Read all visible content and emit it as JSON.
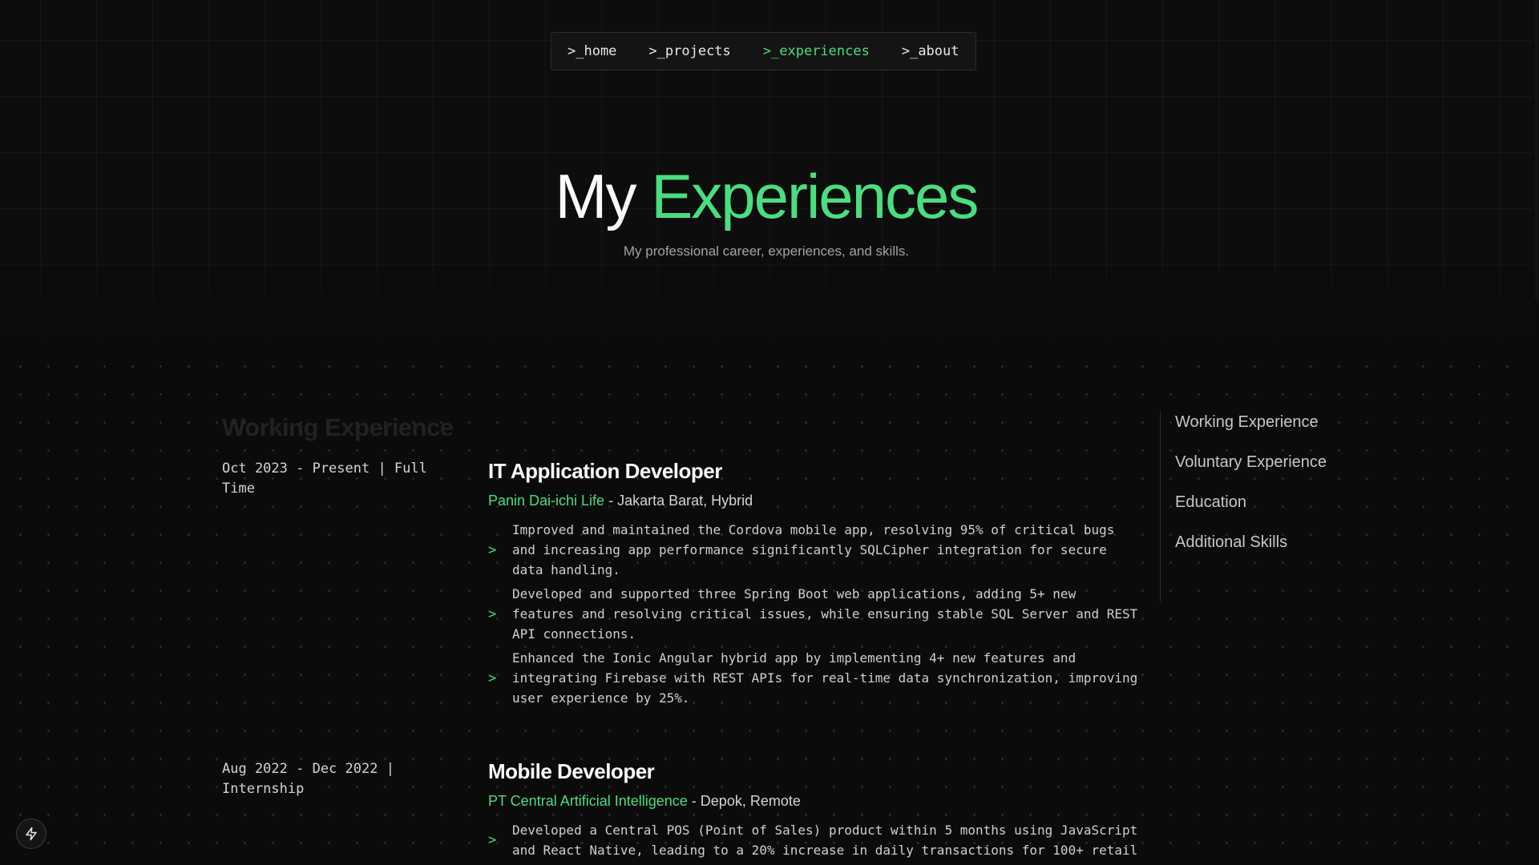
{
  "nav": {
    "items": [
      {
        "label": ">_home"
      },
      {
        "label": ">_projects"
      },
      {
        "label": ">_experiences",
        "active": true
      },
      {
        "label": ">_about"
      }
    ]
  },
  "hero": {
    "title_plain": "My",
    "title_accent": "Experiences",
    "subtitle": "My professional career, experiences, and skills."
  },
  "section": {
    "heading": "Working Experience"
  },
  "experiences": [
    {
      "date": "Oct 2023 - Present | Full Time",
      "role": "IT Application Developer",
      "company": "Panin Dai-ichi Life",
      "location": " - Jakarta Barat, Hybrid",
      "bullets": [
        "Improved and maintained the Cordova mobile app, resolving 95% of critical bugs and increasing app performance significantly SQLCipher integration for secure data handling.",
        "Developed and supported three Spring Boot web applications, adding 5+ new features and resolving critical issues, while ensuring stable SQL Server and REST API connections.",
        "Enhanced the Ionic Angular hybrid app by implementing 4+ new features and integrating Firebase with REST APIs for real-time data synchronization, improving user experience by 25%."
      ]
    },
    {
      "date": "Aug 2022 - Dec 2022 | Internship",
      "role": "Mobile Developer",
      "company": "PT Central Artificial Intelligence",
      "location": " - Depok, Remote",
      "bullets": [
        "Developed a Central POS (Point of Sales) product within 5 months using JavaScript and React Native, leading to a 20% increase in daily transactions for 100+ retail"
      ]
    }
  ],
  "toc": {
    "items": [
      {
        "label": "Working Experience"
      },
      {
        "label": "Voluntary Experience"
      },
      {
        "label": "Education"
      },
      {
        "label": "Additional Skills"
      }
    ]
  },
  "bullet_marker": ">",
  "colors": {
    "accent": "#4ade80",
    "background": "#0b0b0b",
    "text": "#fafafa"
  },
  "icons": {
    "dev_tools": "lightning-bolt-icon"
  }
}
